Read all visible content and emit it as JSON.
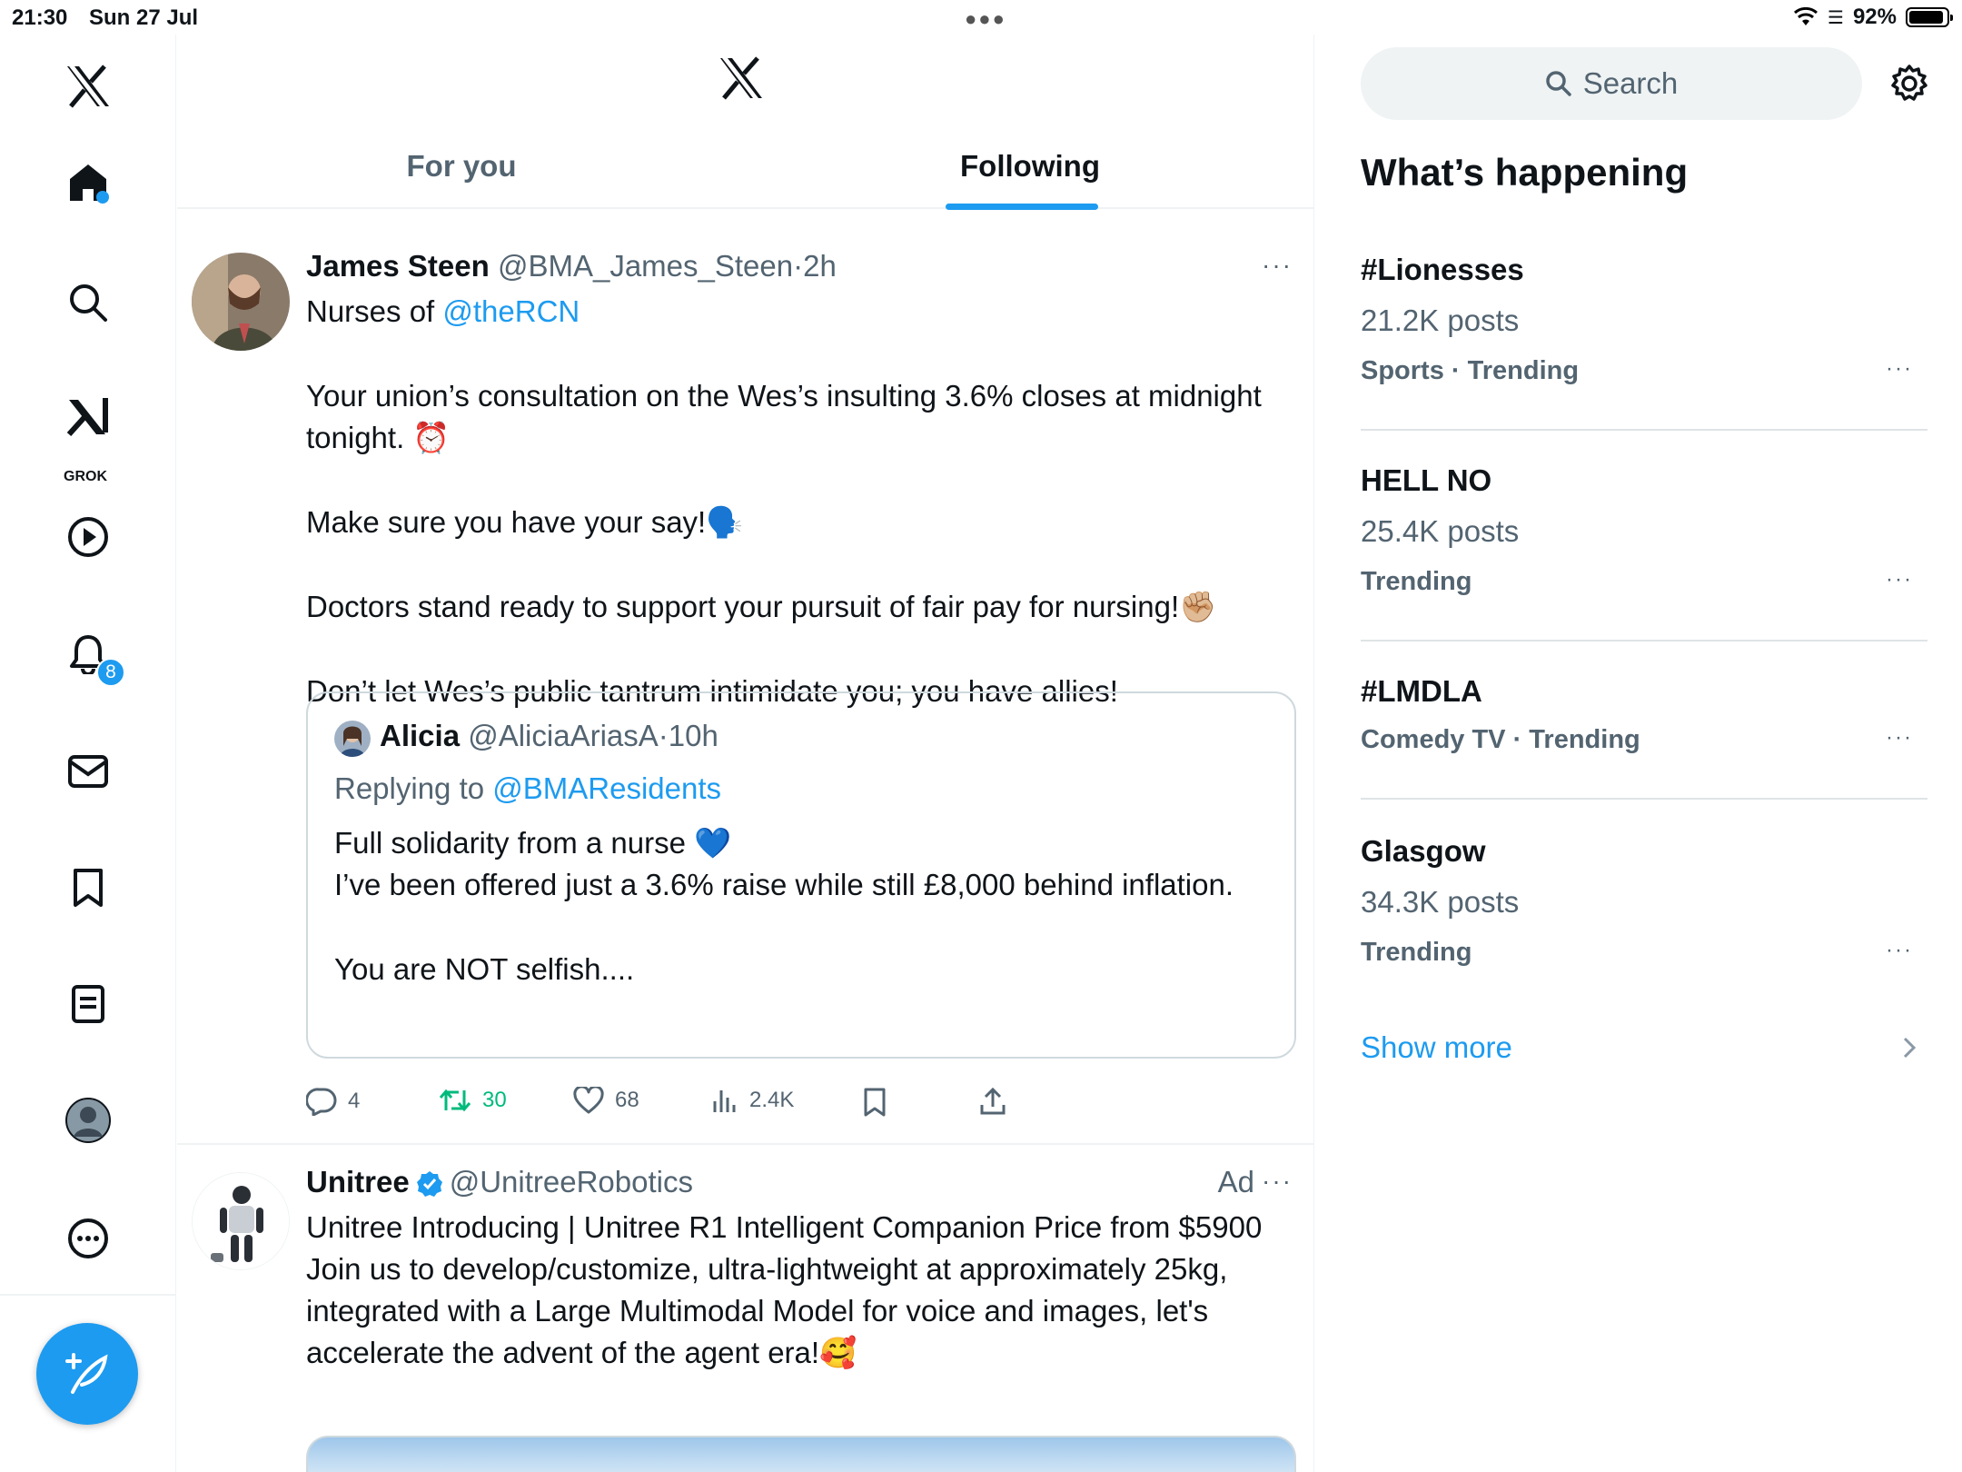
{
  "status_bar": {
    "time": "21:30",
    "date": "Sun 27 Jul",
    "battery": "92%",
    "battery_level": 0.92
  },
  "nav": {
    "items": [
      "x-logo",
      "home-icon",
      "search-icon",
      "grok-icon",
      "play-icon",
      "bell-icon",
      "mail-icon",
      "bookmark-icon",
      "list-icon",
      "profile-icon",
      "more-icon"
    ],
    "grok_label": "GROK",
    "notifications_count": "8",
    "compose_icon": "feather-plus-icon",
    "accent": "#1d9bf0"
  },
  "tabs": [
    {
      "label": "For you",
      "active": false
    },
    {
      "label": "Following",
      "active": true
    }
  ],
  "tweet1": {
    "name": "James Steen",
    "handle": "@BMA_James_Steen",
    "sep": "·",
    "time": "2h",
    "line1_text": "Nurses of ",
    "line1_link": "@theRCN",
    "para1": "Your union’s consultation on the Wes’s insulting 3.6% closes at midnight tonight. ⏰",
    "para2": "Make sure you have your say!🗣️",
    "para3": "Doctors stand ready to support your pursuit of fair pay for nursing!✊🏼",
    "para4": "Don’t let Wes’s public tantrum intimidate you; you have allies!",
    "quote": {
      "name": "Alicia",
      "handle": "@AliciaAriasA",
      "sep": "·",
      "time": "10h",
      "replying_label": "Replying to ",
      "replying_handle": "@BMAResidents",
      "line1": "Full solidarity from a nurse 💙",
      "line2": "I’ve been offered just a 3.6% raise while still £8,000 behind inflation.",
      "line3": "You are NOT selfish...."
    },
    "replies": "4",
    "retweets": "30",
    "likes": "68",
    "views": "2.4K"
  },
  "tweet2": {
    "name": "Unitree",
    "handle": "@UnitreeRobotics",
    "ad": "Ad",
    "line1": "Unitree Introducing | Unitree R1 Intelligent Companion Price from $5900",
    "line2": "Join us to develop/customize, ultra-lightweight at approximately 25kg, integrated with a Large Multimodal Model for voice and images, let's accelerate the advent of the agent era!🥰"
  },
  "sidebar": {
    "search_placeholder": "Search",
    "title": "What’s happening",
    "trends": [
      {
        "title": "#Lionesses",
        "posts": "21.2K posts",
        "meta": "Sports · Trending"
      },
      {
        "title": "HELL NO",
        "posts": "25.4K posts",
        "meta": "Trending"
      },
      {
        "title": "#LMDLA",
        "posts": "",
        "meta": "Comedy TV · Trending"
      },
      {
        "title": "Glasgow",
        "posts": "34.3K posts",
        "meta": "Trending"
      }
    ],
    "show_more": "Show more"
  }
}
